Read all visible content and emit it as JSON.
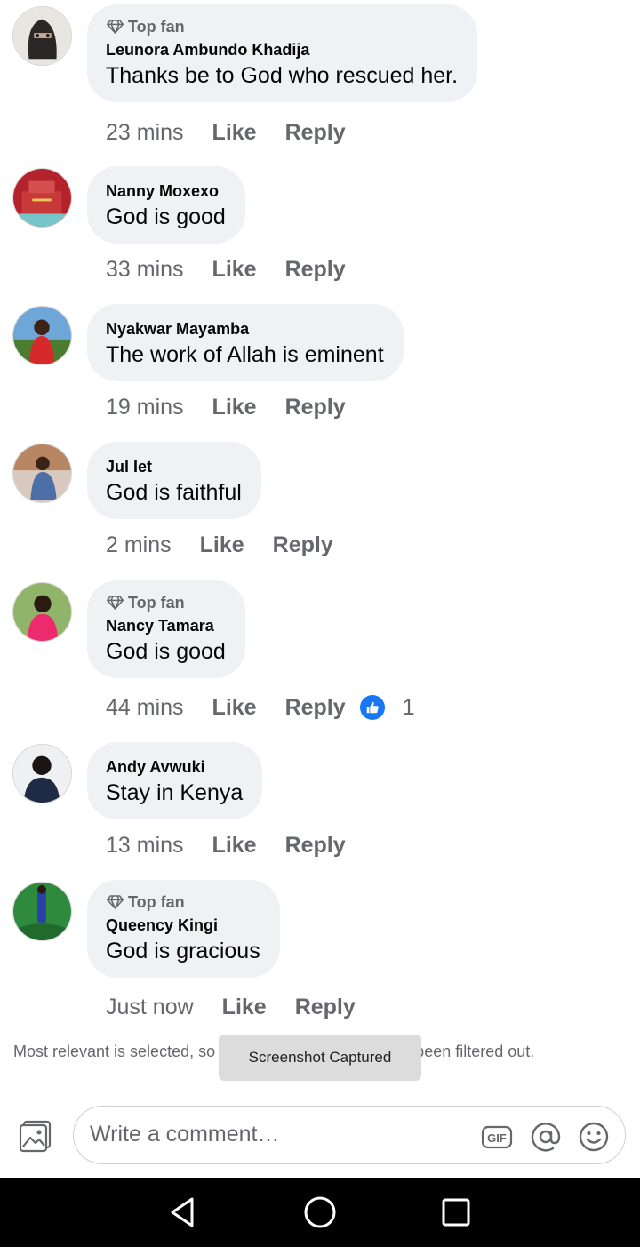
{
  "comments": [
    {
      "top_fan": "Top fan",
      "author": "Leunora Ambundo Khadija",
      "text": "Thanks  be to God who rescued  her.",
      "time": "23 mins",
      "like": "Like",
      "reply": "Reply"
    },
    {
      "author": "Nanny Moxexo",
      "text": "God is good",
      "time": "33 mins",
      "like": "Like",
      "reply": "Reply"
    },
    {
      "author": "Nyakwar Mayamba",
      "text": "The work of Allah is eminent",
      "time": "19 mins",
      "like": "Like",
      "reply": "Reply"
    },
    {
      "author": "Jul Iet",
      "text": "God is faithful",
      "time": "2 mins",
      "like": "Like",
      "reply": "Reply"
    },
    {
      "top_fan": "Top fan",
      "author": "Nancy Tamara",
      "text": "God is good",
      "time": "44 mins",
      "like": "Like",
      "reply": "Reply",
      "reactions": "1"
    },
    {
      "author": "Andy Avwuki",
      "text": "Stay in Kenya",
      "time": "13 mins",
      "like": "Like",
      "reply": "Reply"
    },
    {
      "top_fan": "Top fan",
      "author": "Queency Kingi",
      "text": "God is gracious",
      "time": "Just now",
      "like": "Like",
      "reply": "Reply"
    }
  ],
  "filter_note": "Most relevant is selected, so some comments may have been filtered out.",
  "toast": "Screenshot Captured",
  "composer": {
    "placeholder": "Write a comment…",
    "gif_label": "GIF"
  },
  "icons": {
    "photo": "photo-icon",
    "gif": "gif-icon",
    "mention": "at-icon",
    "emoji": "emoji-icon",
    "back": "back-icon",
    "home": "home-icon",
    "recents": "recents-icon",
    "badge": "diamond-icon",
    "like": "thumbs-up-icon"
  },
  "colors": {
    "bubble": "#eff1f5",
    "accent": "#1877f2",
    "secondary_text": "#65676b"
  }
}
